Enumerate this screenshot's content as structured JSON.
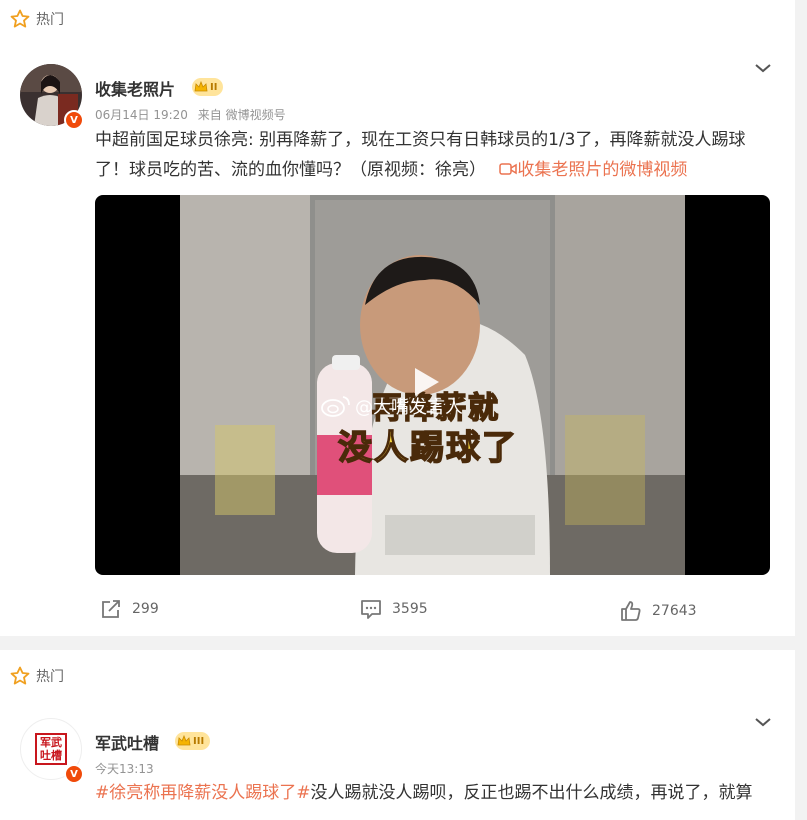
{
  "post1": {
    "hot_label": "热门",
    "author": "收集老照片",
    "level": "II",
    "time": "06月14日 19:20",
    "source": "来自 微博视频号",
    "text_line1": "中超前国足球员徐亮: 别再降薪了，现在工资只有日韩球员的1/3了，再降薪就没人踢球",
    "text_line2_prefix": "了！球员吃的苦、流的血你懂吗？（原视频：徐亮）",
    "video_link": "收集老照片的微博视频",
    "video_caption_line1": "再降薪就",
    "video_caption_line2": "没人踢球了",
    "watermark": "@大嘴发言人",
    "shares": "299",
    "comments": "3595",
    "likes": "27643"
  },
  "post2": {
    "hot_label": "热门",
    "author": "军武吐槽",
    "level": "III",
    "avatar_text": "军武吐槽",
    "time": "今天13:13",
    "hashtag": "#徐亮称再降薪没人踢球了#",
    "text_rest": "没人踢就没人踢呗，反正也踢不出什么成绩，再说了，就算"
  },
  "colors": {
    "accent": "#eb7350",
    "badge": "#f04a0a",
    "level_bg": "#ffe49b"
  }
}
